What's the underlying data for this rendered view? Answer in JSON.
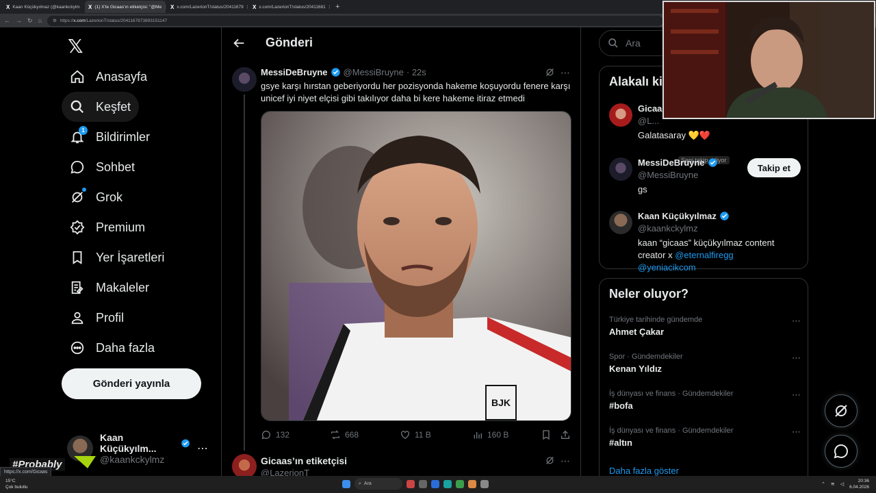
{
  "browser": {
    "tabs": [
      {
        "title": "Kaan Küçükyılmaz (@kaankckylm",
        "active": false
      },
      {
        "title": "(1) X'te Gicaas'ın etiketçisi: \"@Me",
        "active": true
      },
      {
        "title": "x.com/LazerionT/status/20411679",
        "active": false
      },
      {
        "title": "x.com/LazerionT/status/20411681",
        "active": false
      }
    ],
    "url_prefix": "https://",
    "url_host": "x.com",
    "url_path": "/LazerionT/status/2041167873893151147"
  },
  "nav": {
    "items": [
      {
        "label": "Anasayfa",
        "icon": "home-icon"
      },
      {
        "label": "Keşfet",
        "icon": "search-icon"
      },
      {
        "label": "Bildirimler",
        "icon": "bell-icon",
        "badge": "1"
      },
      {
        "label": "Sohbet",
        "icon": "chat-icon"
      },
      {
        "label": "Grok",
        "icon": "grok-icon"
      },
      {
        "label": "Premium",
        "icon": "premium-icon"
      },
      {
        "label": "Yer İşaretleri",
        "icon": "bookmark-icon"
      },
      {
        "label": "Makaleler",
        "icon": "article-icon"
      },
      {
        "label": "Profil",
        "icon": "profile-icon"
      },
      {
        "label": "Daha fazla",
        "icon": "more-circle-icon"
      }
    ],
    "post_button": "Gönderi yayınla",
    "account": {
      "name": "Kaan Küçükyılm...",
      "handle": "@kaankckylmz"
    },
    "overlay_tag": "#Probably",
    "status_url": "https://x.com/Gicaas"
  },
  "main": {
    "title": "Gönderi",
    "tweet": {
      "name": "MessiDeBruyne",
      "handle": "@MessiBruyne",
      "time": "· 22s",
      "text": "gsye karşı hırstan geberiyordu her pozisyonda hakeme koşuyordu fenere karşı unicef iyi niyet elçisi gibi takılıyor daha bi kere hakeme itiraz etmedi",
      "stats": {
        "replies": "132",
        "reposts": "668",
        "likes": "11 B",
        "views": "160 B"
      }
    },
    "reply": {
      "name": "Gicaas’ın etiketçisi",
      "handle": "@LazerionT"
    }
  },
  "sidebar": {
    "search_placeholder": "Ara",
    "related_title": "Alakalı ki",
    "people": [
      {
        "name": "Gicaa",
        "handle": "@L...",
        "bio": "Galatasaray 💛❤️",
        "follow": ""
      },
      {
        "name": "MessiDeBruyne",
        "handle": "@MessiBruyne",
        "bio": "gs",
        "follow": "Takip et"
      },
      {
        "name": "Kaan Küçükyılmaz",
        "handle": "@kaankckylmz",
        "bio": "kaan “gicaas” küçükyılmaz content creator x ",
        "mentions": "@eternalfiregg @yeniacikcom",
        "follow": ""
      }
    ],
    "tooltip": "Seni takip ediyor",
    "trends_title": "Neler oluyor?",
    "trends": [
      {
        "context": "Türkiye tarihinde gündemde",
        "topic": "Ahmet Çakar"
      },
      {
        "context": "Spor · Gündemdekiler",
        "topic": "Kenan Yıldız"
      },
      {
        "context": "İş dünyası ve finans · Gündemdekiler",
        "topic": "#bofa"
      },
      {
        "context": "İş dünyası ve finans · Gündemdekiler",
        "topic": "#altın"
      }
    ],
    "show_more": "Daha fazla göster"
  },
  "taskbar": {
    "temp": "15°C",
    "weather": "Çok bulutlu",
    "search": "Ara",
    "time": "20:36",
    "date": "6.04.2026"
  },
  "colors": {
    "accent": "#1d9bf0",
    "bg": "#000000",
    "border": "#2f3336",
    "muted": "#71767b"
  }
}
